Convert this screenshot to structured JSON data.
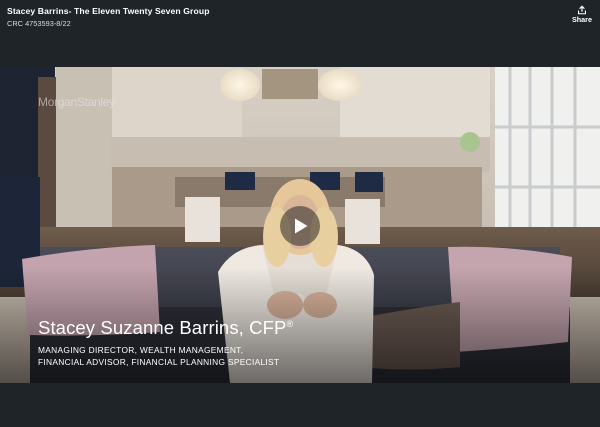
{
  "header": {
    "title": "Stacey Barrins- The Eleven Twenty Seven Group",
    "subtitle": "CRC 4753593-8/22",
    "share_label": "Share"
  },
  "video": {
    "watermark": "MorganStanley",
    "lower_third": {
      "name": "Stacey Suzanne Barrins, CFP",
      "name_mark": "®",
      "role_line1": "MANAGING DIRECTOR, WEALTH MANAGEMENT,",
      "role_line2": "FINANCIAL ADVISOR, FINANCIAL PLANNING SPECIALIST"
    }
  },
  "icons": {
    "share": "share-icon",
    "play": "play-icon"
  },
  "colors": {
    "background": "#1e2427",
    "text": "#ffffff"
  }
}
